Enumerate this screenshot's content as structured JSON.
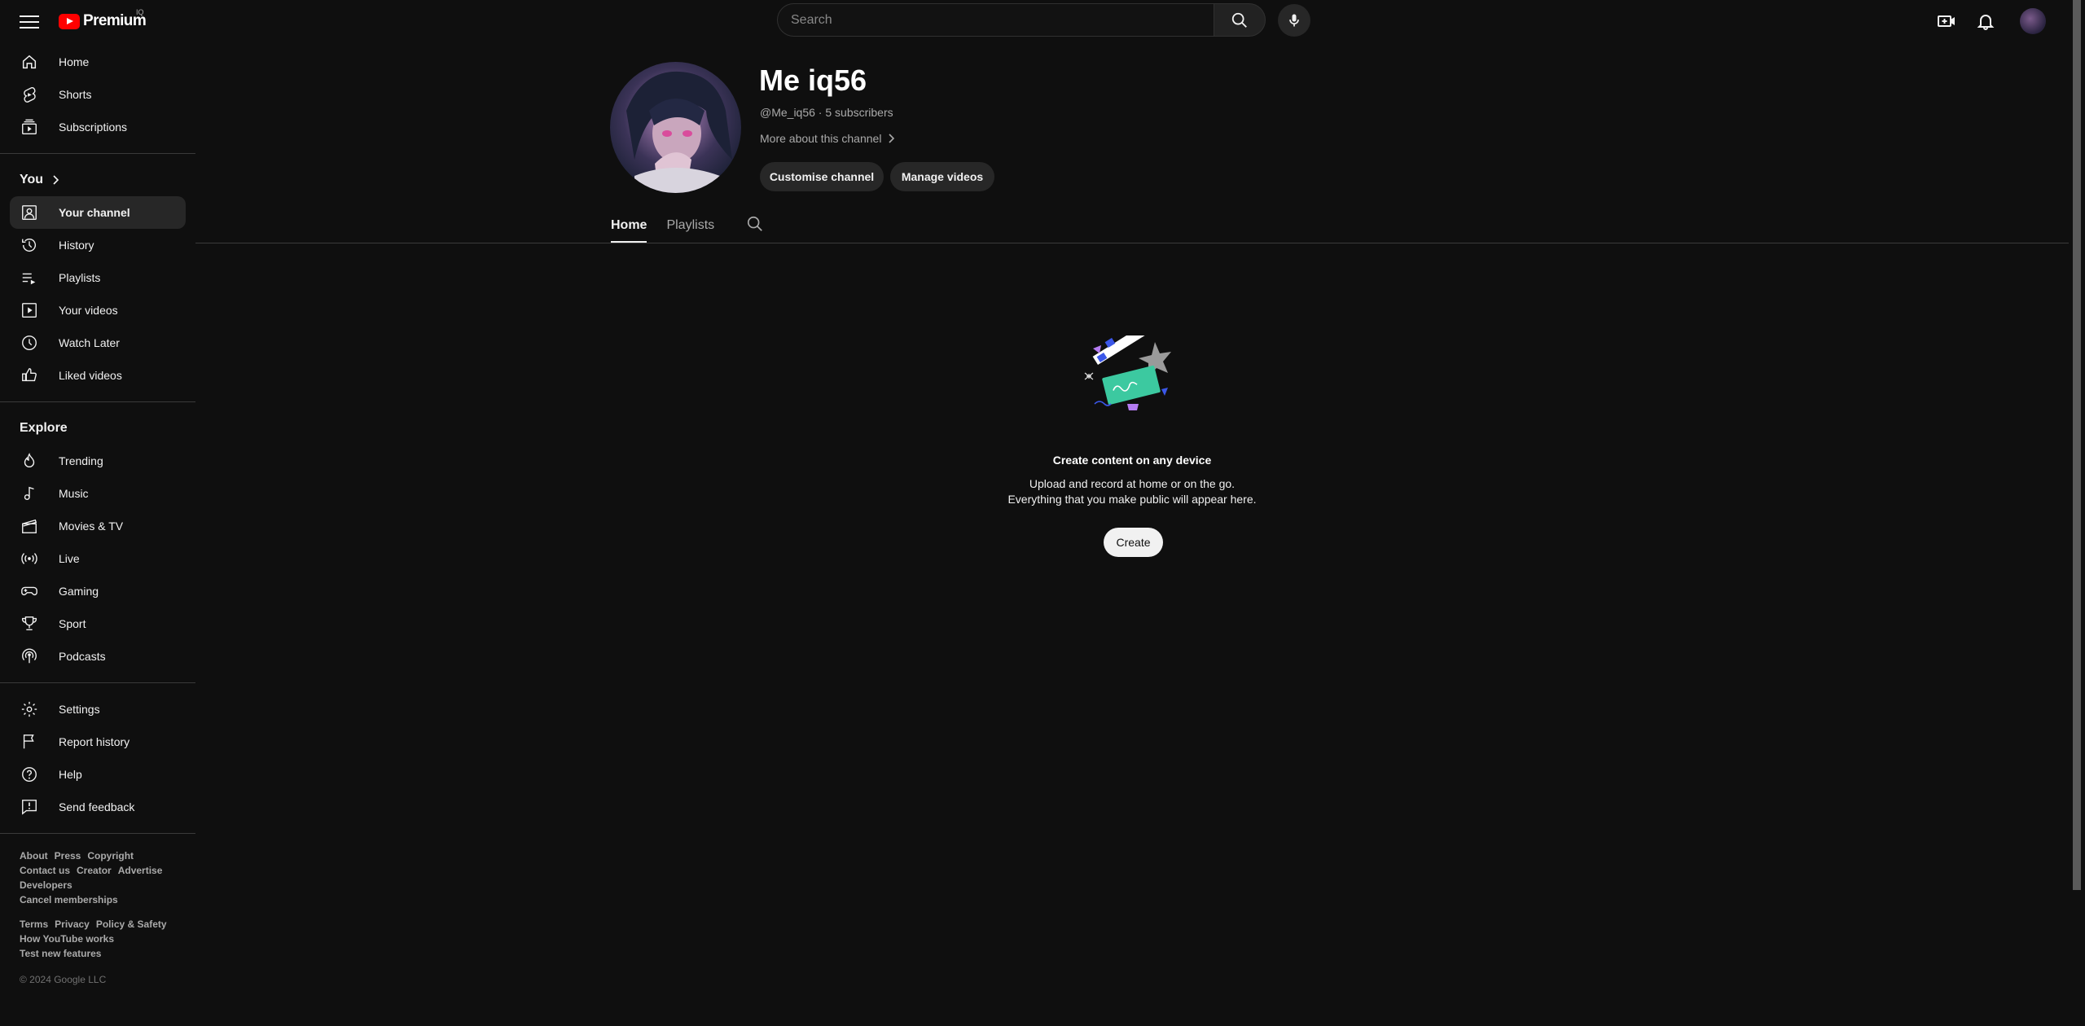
{
  "topbar": {
    "logo_text": "Premium",
    "logo_country": "IQ",
    "search_placeholder": "Search"
  },
  "sidebar": {
    "main": [
      {
        "label": "Home",
        "icon": "home-icon"
      },
      {
        "label": "Shorts",
        "icon": "shorts-icon"
      },
      {
        "label": "Subscriptions",
        "icon": "subscriptions-icon"
      }
    ],
    "you_header": "You",
    "you": [
      {
        "label": "Your channel",
        "icon": "your-channel-icon",
        "active": true
      },
      {
        "label": "History",
        "icon": "history-icon"
      },
      {
        "label": "Playlists",
        "icon": "playlists-icon"
      },
      {
        "label": "Your videos",
        "icon": "your-videos-icon"
      },
      {
        "label": "Watch Later",
        "icon": "watch-later-icon"
      },
      {
        "label": "Liked videos",
        "icon": "liked-videos-icon"
      }
    ],
    "explore_header": "Explore",
    "explore": [
      {
        "label": "Trending",
        "icon": "trending-icon"
      },
      {
        "label": "Music",
        "icon": "music-icon"
      },
      {
        "label": "Movies & TV",
        "icon": "movies-icon"
      },
      {
        "label": "Live",
        "icon": "live-icon"
      },
      {
        "label": "Gaming",
        "icon": "gaming-icon"
      },
      {
        "label": "Sport",
        "icon": "sport-icon"
      },
      {
        "label": "Podcasts",
        "icon": "podcasts-icon"
      }
    ],
    "settings": [
      {
        "label": "Settings",
        "icon": "settings-icon"
      },
      {
        "label": "Report history",
        "icon": "flag-icon"
      },
      {
        "label": "Help",
        "icon": "help-icon"
      },
      {
        "label": "Send feedback",
        "icon": "feedback-icon"
      }
    ],
    "footer1": [
      "About",
      "Press",
      "Copyright",
      "Contact us",
      "Creator",
      "Advertise",
      "Developers",
      "Cancel memberships"
    ],
    "footer2": [
      "Terms",
      "Privacy",
      "Policy & Safety",
      "How YouTube works",
      "Test new features"
    ],
    "copyright": "© 2024 Google LLC"
  },
  "channel": {
    "name": "Me iq56",
    "meta": "@Me_iq56 · 5 subscribers",
    "more": "More about this channel",
    "customise_label": "Customise channel",
    "manage_label": "Manage videos",
    "tabs": [
      "Home",
      "Playlists"
    ]
  },
  "empty_state": {
    "title": "Create content on any device",
    "desc_line1": "Upload and record at home or on the go.",
    "desc_line2": "Everything that you make public will appear here.",
    "create_label": "Create"
  },
  "colors": {
    "background": "#0f0f0f",
    "youtube_red": "#ff0000",
    "button_bg": "#272727",
    "text": "#f1f1f1",
    "muted": "#aaaaaa"
  }
}
